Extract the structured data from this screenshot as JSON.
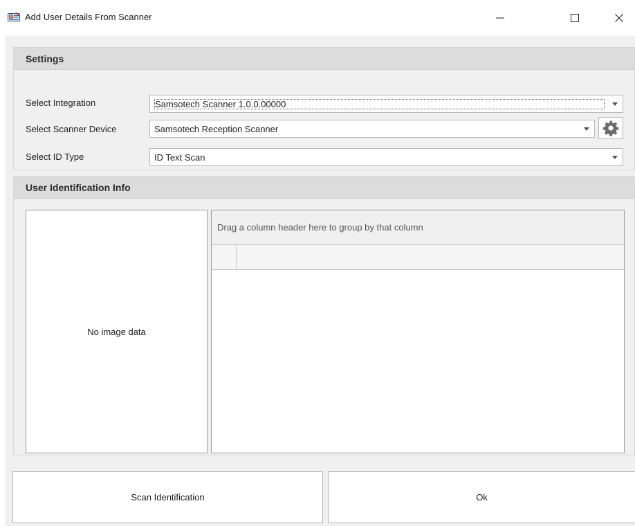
{
  "window": {
    "title": "Add User Details From Scanner",
    "minimize_glyph": "—",
    "maximize_glyph": "☐",
    "close_glyph": "✕"
  },
  "settings": {
    "header": "Settings",
    "integration": {
      "label": "Select Integration",
      "value": "Samsotech Scanner 1.0.0.00000"
    },
    "scanner_device": {
      "label": "Select Scanner Device",
      "value": "Samsotech Reception Scanner"
    },
    "id_type": {
      "label": "Select ID Type",
      "value": "ID Text Scan"
    }
  },
  "identification": {
    "header": "User Identification Info",
    "image_placeholder": "No image data",
    "group_panel_hint": "Drag a column header here to group by that column"
  },
  "buttons": {
    "scan": "Scan Identification",
    "ok": "Ok"
  },
  "icons": {
    "app": "scanner-card-icon",
    "gear": "gear-icon",
    "dropdown": "chevron-down-icon"
  },
  "colors": {
    "panel_header_bg": "#dcdcdc",
    "client_bg": "#f0f0f0",
    "gear": "#6b6b6b"
  }
}
